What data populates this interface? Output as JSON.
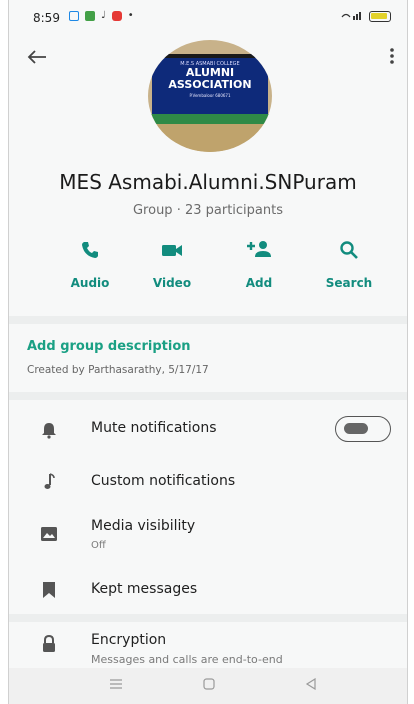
{
  "status_bar": {
    "time": "8:59",
    "colors": {
      "app1": "#1e88e5",
      "app2": "#43a047",
      "app3": "#e53935"
    }
  },
  "header": {
    "back_icon": "arrow-left",
    "more_icon": "more-vertical"
  },
  "group": {
    "avatar_banner": {
      "line1": "M.E.S ASMABI COLLEGE",
      "line2": "ALUMNI",
      "line3": "ASSOCIATION",
      "line4": "P.Vembaloor 680671"
    },
    "name": "MES Asmabi.Alumni.SNPuram",
    "subtitle": "Group · 23 participants"
  },
  "actions": [
    {
      "label": "Audio",
      "icon": "phone-icon"
    },
    {
      "label": "Video",
      "icon": "video-icon"
    },
    {
      "label": "Add",
      "icon": "add-person-icon"
    },
    {
      "label": "Search",
      "icon": "search-icon"
    }
  ],
  "description": {
    "add_label": "Add group description",
    "created": "Created by Parthasarathy, 5/17/17"
  },
  "settings": {
    "mute": {
      "title": "Mute notifications",
      "enabled": false
    },
    "custom": {
      "title": "Custom notifications"
    },
    "media": {
      "title": "Media visibility",
      "value": "Off"
    },
    "kept": {
      "title": "Kept messages"
    },
    "encryption": {
      "title": "Encryption",
      "sub": "Messages and calls are end-to-end"
    }
  },
  "accent_color": "#128c7e"
}
